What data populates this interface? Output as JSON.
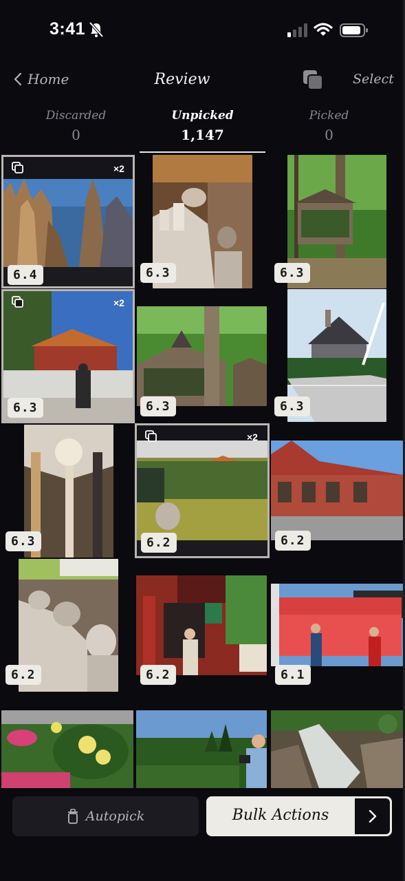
{
  "status_bar": {
    "time": "3:41"
  },
  "nav": {
    "back_label": "Home",
    "title": "Review",
    "select_label": "Select"
  },
  "tabs": [
    {
      "label": "Discarded",
      "count": "0"
    },
    {
      "label": "Unpicked",
      "count": "1,147"
    },
    {
      "label": "Picked",
      "count": "0"
    }
  ],
  "grid": {
    "scores": [
      "6.4",
      "6.3",
      "6.3",
      "6.3",
      "6.3",
      "6.3",
      "6.3",
      "6.2",
      "6.2",
      "6.2",
      "6.2",
      "6.1"
    ],
    "duplicate_counts": [
      "×2",
      "×2",
      "×2"
    ]
  },
  "bottom": {
    "autopick_label": "Autopick",
    "bulk_actions_label": "Bulk Actions"
  },
  "colors": {
    "background": "#0b0a0e",
    "badge_bg": "#ecebe6",
    "selected_border": "#b9b6b2",
    "bulk_bg": "#ecebe6"
  }
}
